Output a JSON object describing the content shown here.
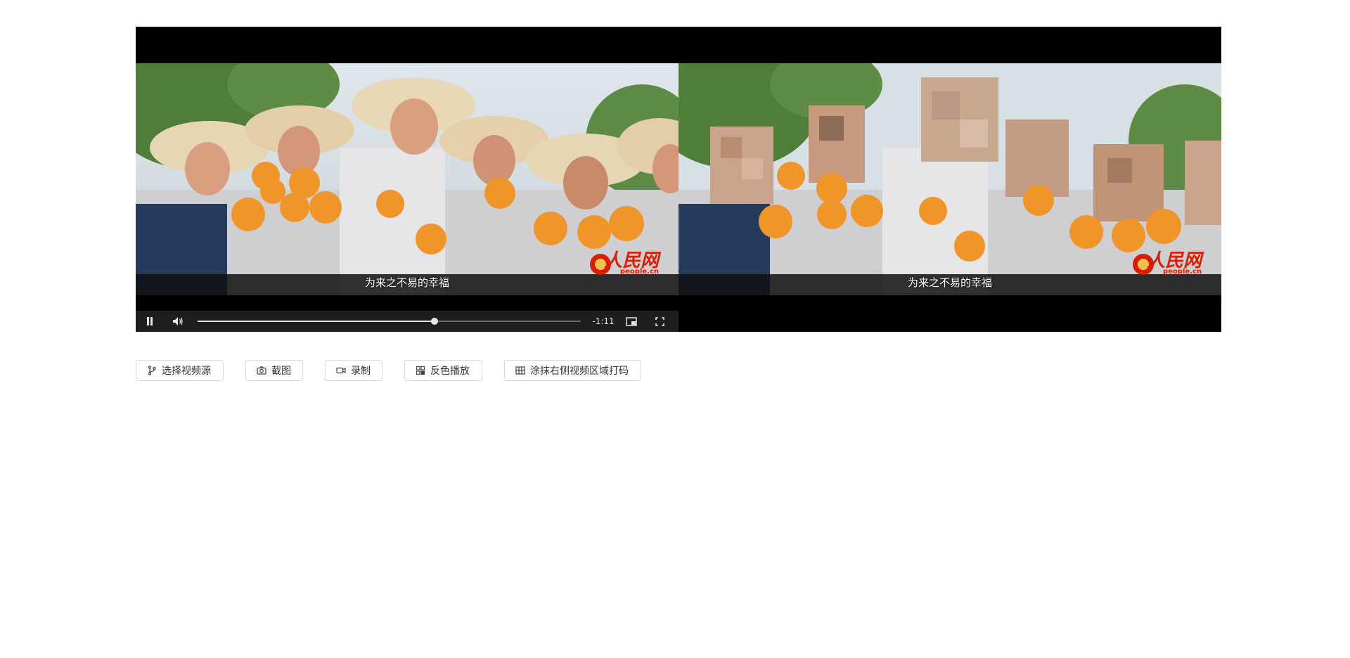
{
  "player": {
    "subtitle_left": "为来之不易的幸福",
    "subtitle_right": "为来之不易的幸福",
    "logo_text": "人民网",
    "logo_sub": "people.cn",
    "time_remaining": "-1:11",
    "progress": 0.618
  },
  "controls": {
    "play_state": "pause-icon",
    "volume": "volume-icon",
    "pip": "picture-in-picture-icon",
    "fullscreen": "fullscreen-icon"
  },
  "toolbar": {
    "select_source_label": "选择视频源",
    "screenshot_label": "截图",
    "record_label": "录制",
    "invert_play_label": "反色播放",
    "mosaic_label": "涂抹右侧视频区域打码"
  },
  "colors": {
    "control_bar": "#1e1e22",
    "logo_red": "#d81e06",
    "button_border": "#d9d9d9"
  }
}
